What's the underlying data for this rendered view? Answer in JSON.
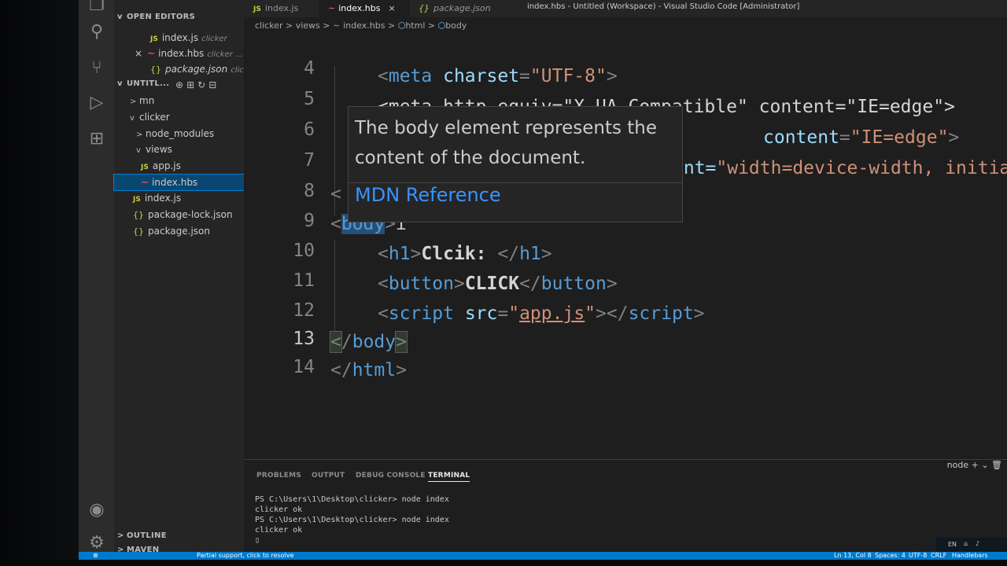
{
  "window": {
    "title": "index.hbs - Untitled (Workspace) - Visual Studio Code [Administrator]"
  },
  "tabs": [
    {
      "label": "index.js",
      "badge": "JS",
      "active": false
    },
    {
      "label": "index.hbs",
      "badge": "~",
      "active": true
    },
    {
      "label": "package.json",
      "badge": "{}",
      "active": false
    }
  ],
  "breadcrumb": {
    "parts": [
      "clicker",
      "views",
      "index.hbs",
      "html",
      "body"
    ],
    "separator": ">"
  },
  "sidebar": {
    "open_editors_title": "OPEN EDITORS",
    "open_editors": [
      {
        "badge": "JS",
        "name": "index.js",
        "hint": "clicker"
      },
      {
        "badge": "~",
        "name": "index.hbs",
        "hint": "clicker ...",
        "close": "×"
      },
      {
        "badge": "{}",
        "name": "package.json",
        "hint": "clic..."
      }
    ],
    "workspace_title": "UNTITL...",
    "tree": [
      {
        "chevron": ">",
        "name": "mn"
      },
      {
        "chevron": "v",
        "name": "clicker"
      },
      {
        "chevron": ">",
        "name": "node_modules"
      },
      {
        "chevron": "v",
        "name": "views"
      },
      {
        "badge": "JS",
        "name": "app.js"
      },
      {
        "badge": "~",
        "name": "index.hbs"
      },
      {
        "badge": "JS",
        "name": "index.js"
      },
      {
        "badge": "{}",
        "name": "package-lock.json"
      },
      {
        "badge": "{}",
        "name": "package.json"
      }
    ],
    "outline_title": "OUTLINE",
    "maven_title": "MAVEN"
  },
  "editor": {
    "line_numbers": [
      "4",
      "5",
      "6",
      "7",
      "8",
      "9",
      "10",
      "11",
      "12",
      "13",
      "14"
    ],
    "current_line": "13",
    "lines": {
      "l4": {
        "tag": "meta",
        "attr": "charset",
        "value": "\"UTF-8\""
      },
      "l5": {
        "partial": "<meta http-equiv=\"X-UA-Compatible\" content=\"IE=edge\">",
        "attr2": "content",
        "value2": "\"IE=edge\""
      },
      "l7": {
        "partial": "ent=",
        "value": "\"width=device-width, initial-s"
      },
      "l8": {
        "partial": "<"
      },
      "l9": {
        "tag": "body"
      },
      "l10": {
        "tag": "h1",
        "text": "Clcik: ",
        "close": "h1"
      },
      "l11": {
        "tag": "button",
        "text": "CLICK",
        "close": "button"
      },
      "l12": {
        "tag": "script",
        "attr": "src",
        "value": "app.js",
        "close": "script"
      },
      "l13": {
        "close": "body"
      },
      "l14": {
        "close": "html"
      }
    }
  },
  "hover": {
    "description": "The body element represents the content of the document.",
    "link": "MDN Reference"
  },
  "panel": {
    "tabs": [
      "PROBLEMS",
      "OUTPUT",
      "DEBUG CONSOLE",
      "TERMINAL"
    ],
    "active_tab": "TERMINAL",
    "terminal_selector": "node",
    "terminal_lines": [
      "PS C:\\Users\\1\\Desktop\\clicker> node index",
      "clicker ok",
      "PS C:\\Users\\1\\Desktop\\clicker> node index",
      "clicker ok",
      "▯"
    ]
  },
  "statusbar": {
    "left_message": "Partial support, click to resolve",
    "position": "Ln 13, Col 8",
    "spaces": "Spaces: 4",
    "encoding": "UTF-8",
    "eol": "CRLF",
    "language": "Handlebars"
  },
  "taskbar": {
    "lang": "EN"
  },
  "colors": {
    "accent": "#007acc",
    "selection": "#094771",
    "tag": "#569cd6",
    "attr": "#9cdcfe",
    "string": "#ce9178"
  }
}
